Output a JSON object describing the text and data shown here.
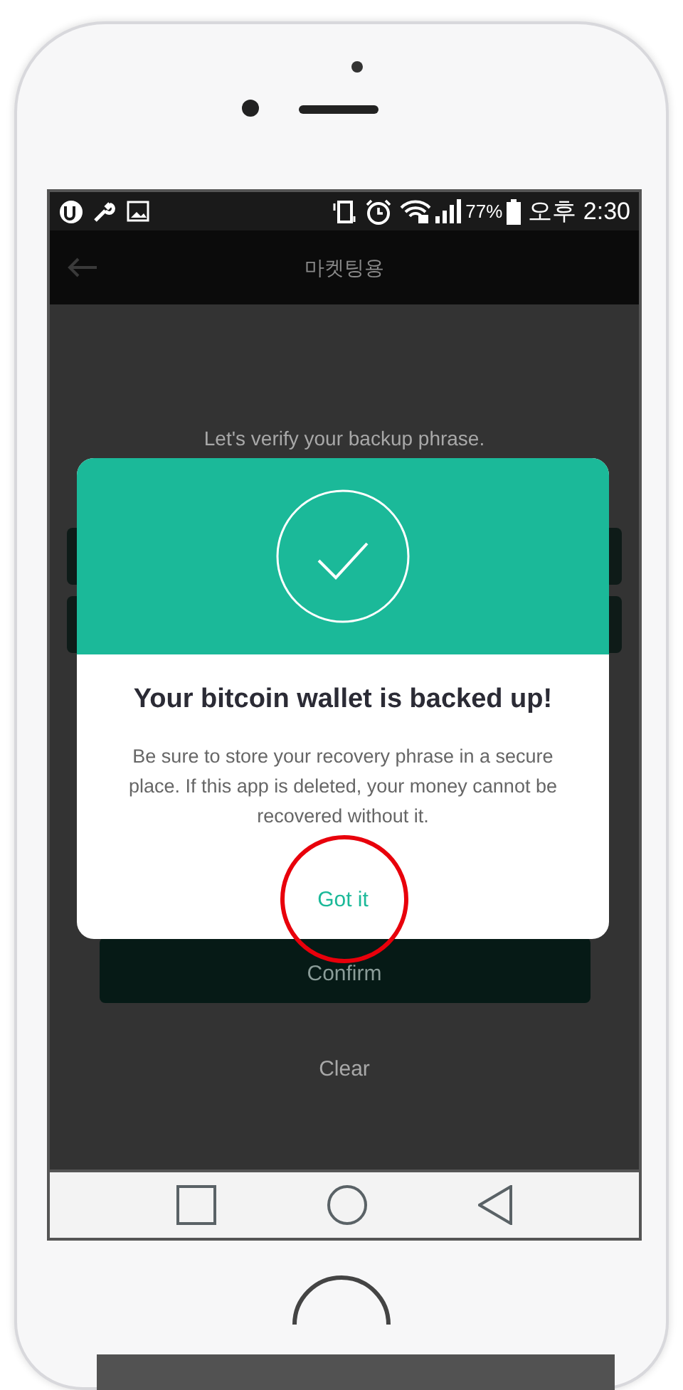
{
  "status_bar": {
    "battery": "77%",
    "time": "오후 2:30"
  },
  "app_bar": {
    "title": "마켓팅용"
  },
  "screen": {
    "prompt": "Let's verify your backup phrase.",
    "confirm_button": "Confirm",
    "clear_button": "Clear"
  },
  "dialog": {
    "title": "Your bitcoin wallet is backed up!",
    "message": "Be sure to store your recovery phrase in a secure place. If this app is deleted, your money cannot be recovered without it.",
    "button": "Got it"
  }
}
